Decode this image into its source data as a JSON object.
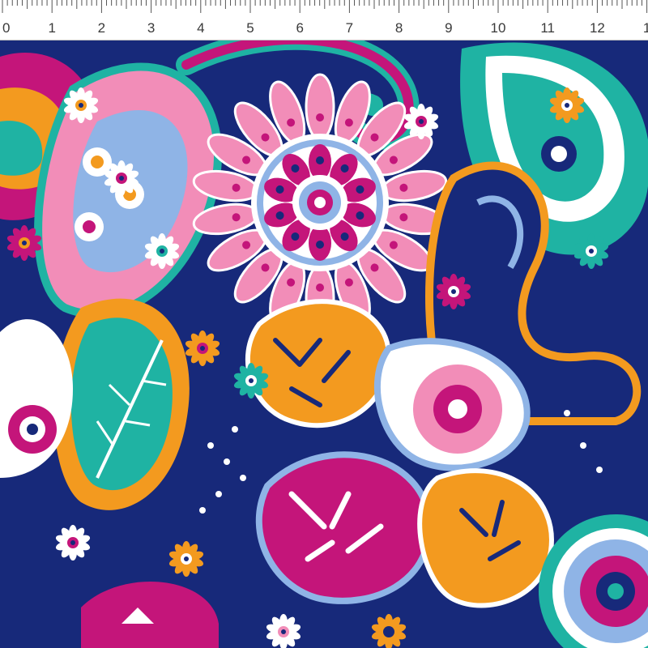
{
  "ruler": {
    "unit_labels": [
      "0",
      "1",
      "2",
      "3",
      "4",
      "5",
      "6",
      "7",
      "8",
      "9",
      "10",
      "11",
      "12",
      "1"
    ]
  },
  "palette": {
    "navy": "#17297a",
    "magenta": "#c4157a",
    "pink": "#f28db8",
    "orange": "#f39a1f",
    "teal": "#1fb3a3",
    "light_blue": "#8fb4e6",
    "white": "#ffffff",
    "purple": "#6b3fa0"
  },
  "motifs": [
    "paisley",
    "mandala-flower",
    "daisy",
    "leaf",
    "dot-border"
  ]
}
